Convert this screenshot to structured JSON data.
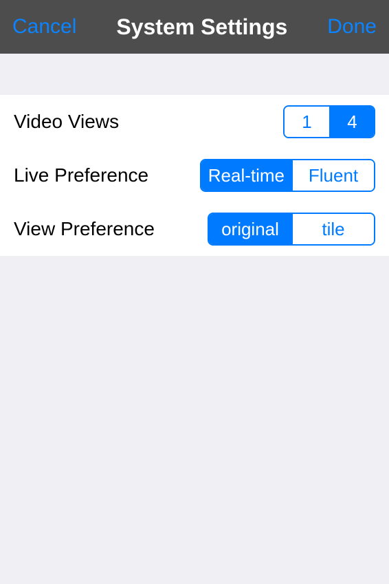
{
  "navbar": {
    "cancel": "Cancel",
    "title": "System Settings",
    "done": "Done"
  },
  "settings": {
    "videoViews": {
      "label": "Video Views",
      "options": [
        "1",
        "4"
      ],
      "selected": "4"
    },
    "livePreference": {
      "label": "Live Preference",
      "options": [
        "Real-time",
        "Fluent"
      ],
      "selected": "Real-time"
    },
    "viewPreference": {
      "label": "View Preference",
      "options": [
        "original",
        "tile"
      ],
      "selected": "original"
    }
  }
}
